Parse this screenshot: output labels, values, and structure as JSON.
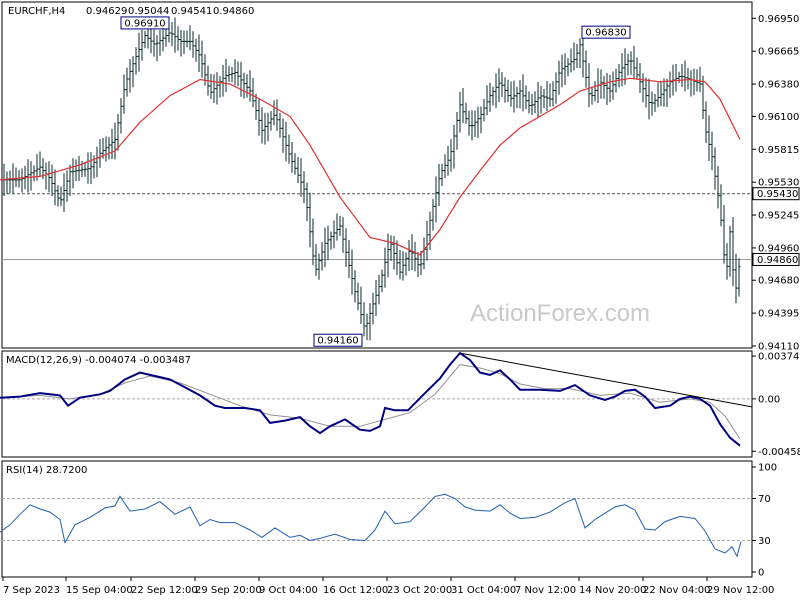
{
  "chart_data": [
    {
      "type": "bar",
      "subtype": "ohlc",
      "title": "EURCHF,H4",
      "ohlc_header": [
        "0.94629",
        "0.95044",
        "0.94541",
        "0.94860"
      ],
      "ylim": [
        0.9411,
        0.9697
      ],
      "yticks": [
        "0.96950",
        "0.96665",
        "0.96380",
        "0.96100",
        "0.95815",
        "0.95530",
        "0.95245",
        "0.94960",
        "0.94680",
        "0.94395",
        "0.94110"
      ],
      "xticks": [
        "7 Sep 2023",
        "15 Sep 04:00",
        "22 Sep 12:00",
        "29 Sep 20:00",
        "9 Oct 04:00",
        "16 Oct 12:00",
        "23 Oct 20:00",
        "31 Oct 04:00",
        "7 Nov 12:00",
        "14 Nov 20:00",
        "22 Nov 04:00",
        "29 Nov 12:00"
      ],
      "price_trajectory": [
        [
          0,
          0.9555
        ],
        [
          20,
          0.9555
        ],
        [
          40,
          0.9566
        ],
        [
          50,
          0.9556
        ],
        [
          60,
          0.9535
        ],
        [
          70,
          0.9562
        ],
        [
          90,
          0.9565
        ],
        [
          100,
          0.9578
        ],
        [
          115,
          0.959
        ],
        [
          125,
          0.9638
        ],
        [
          135,
          0.966
        ],
        [
          145,
          0.968
        ],
        [
          155,
          0.9672
        ],
        [
          170,
          0.9683
        ],
        [
          180,
          0.9675
        ],
        [
          190,
          0.9675
        ],
        [
          200,
          0.9662
        ],
        [
          210,
          0.963
        ],
        [
          225,
          0.9645
        ],
        [
          235,
          0.9648
        ],
        [
          250,
          0.9632
        ],
        [
          262,
          0.9598
        ],
        [
          275,
          0.9612
        ],
        [
          290,
          0.9575
        ],
        [
          305,
          0.9545
        ],
        [
          315,
          0.9475
        ],
        [
          325,
          0.95
        ],
        [
          340,
          0.9515
        ],
        [
          355,
          0.9458
        ],
        [
          365,
          0.9425
        ],
        [
          372,
          0.9445
        ],
        [
          380,
          0.9465
        ],
        [
          390,
          0.9502
        ],
        [
          400,
          0.9475
        ],
        [
          410,
          0.9495
        ],
        [
          420,
          0.9478
        ],
        [
          430,
          0.952
        ],
        [
          440,
          0.956
        ],
        [
          450,
          0.9575
        ],
        [
          460,
          0.962
        ],
        [
          470,
          0.96
        ],
        [
          480,
          0.961
        ],
        [
          490,
          0.9628
        ],
        [
          500,
          0.964
        ],
        [
          510,
          0.9625
        ],
        [
          520,
          0.9632
        ],
        [
          530,
          0.9618
        ],
        [
          540,
          0.9628
        ],
        [
          550,
          0.9625
        ],
        [
          560,
          0.965
        ],
        [
          575,
          0.966
        ],
        [
          580,
          0.9672
        ],
        [
          590,
          0.9625
        ],
        [
          600,
          0.964
        ],
        [
          610,
          0.9632
        ],
        [
          620,
          0.965
        ],
        [
          630,
          0.966
        ],
        [
          640,
          0.964
        ],
        [
          650,
          0.962
        ],
        [
          660,
          0.9628
        ],
        [
          670,
          0.964
        ],
        [
          680,
          0.9645
        ],
        [
          690,
          0.9642
        ],
        [
          700,
          0.9638
        ],
        [
          705,
          0.96
        ],
        [
          712,
          0.9575
        ],
        [
          720,
          0.953
        ],
        [
          726,
          0.947
        ],
        [
          730,
          0.951
        ],
        [
          735,
          0.9455
        ],
        [
          740,
          0.9486
        ]
      ],
      "moving_average": [
        [
          0,
          0.9555
        ],
        [
          40,
          0.9558
        ],
        [
          80,
          0.9568
        ],
        [
          115,
          0.958
        ],
        [
          140,
          0.9605
        ],
        [
          170,
          0.9628
        ],
        [
          200,
          0.9642
        ],
        [
          230,
          0.9638
        ],
        [
          260,
          0.9625
        ],
        [
          290,
          0.961
        ],
        [
          310,
          0.9585
        ],
        [
          340,
          0.954
        ],
        [
          370,
          0.9505
        ],
        [
          395,
          0.95
        ],
        [
          420,
          0.949
        ],
        [
          440,
          0.9512
        ],
        [
          460,
          0.954
        ],
        [
          480,
          0.9563
        ],
        [
          500,
          0.9585
        ],
        [
          520,
          0.96
        ],
        [
          540,
          0.961
        ],
        [
          560,
          0.962
        ],
        [
          580,
          0.9632
        ],
        [
          610,
          0.964
        ],
        [
          630,
          0.9643
        ],
        [
          660,
          0.964
        ],
        [
          690,
          0.9642
        ],
        [
          705,
          0.964
        ],
        [
          720,
          0.9625
        ],
        [
          740,
          0.959
        ]
      ],
      "moving_average_color": "#e03030",
      "bar_color": "#0a2a2a",
      "price_labels": [
        {
          "text": "0.96910",
          "value": 0.9691,
          "x": 145
        },
        {
          "text": "0.96830",
          "value": 0.9683,
          "x": 606
        },
        {
          "text": "0.94160",
          "value": 0.9416,
          "x": 338
        }
      ],
      "reference_levels": [
        {
          "value": 0.9543,
          "label": "0.95430",
          "style": "dashed"
        },
        {
          "value": 0.9486,
          "label": "0.94860",
          "style": "solid"
        }
      ],
      "watermark": "ActionForex.com"
    },
    {
      "type": "line",
      "title": "MACD(12,26,9) -0.004074 -0.003487",
      "ylim": [
        -0.005,
        0.0041
      ],
      "yticks": [
        "0.003743",
        "0.00",
        "-0.004585"
      ],
      "macd_trajectory": [
        [
          0,
          0.0001
        ],
        [
          20,
          0.0002
        ],
        [
          40,
          0.0005
        ],
        [
          50,
          0.0004
        ],
        [
          60,
          0.0003
        ],
        [
          68,
          -0.0006
        ],
        [
          80,
          0.0001
        ],
        [
          100,
          0.0004
        ],
        [
          110,
          0.0007
        ],
        [
          125,
          0.0017
        ],
        [
          140,
          0.0023
        ],
        [
          150,
          0.0021
        ],
        [
          160,
          0.0019
        ],
        [
          170,
          0.0017
        ],
        [
          185,
          0.001
        ],
        [
          200,
          0.0003
        ],
        [
          215,
          -0.0006
        ],
        [
          225,
          -0.0008
        ],
        [
          245,
          -0.0008
        ],
        [
          260,
          -0.001
        ],
        [
          270,
          -0.0021
        ],
        [
          285,
          -0.0019
        ],
        [
          300,
          -0.0016
        ],
        [
          310,
          -0.0024
        ],
        [
          320,
          -0.003
        ],
        [
          330,
          -0.0024
        ],
        [
          345,
          -0.0018
        ],
        [
          360,
          -0.0027
        ],
        [
          370,
          -0.0028
        ],
        [
          380,
          -0.0024
        ],
        [
          385,
          -0.0008
        ],
        [
          395,
          -0.001
        ],
        [
          408,
          -0.001
        ],
        [
          425,
          0.0005
        ],
        [
          440,
          0.0018
        ],
        [
          450,
          0.003
        ],
        [
          460,
          0.004
        ],
        [
          470,
          0.0034
        ],
        [
          480,
          0.0023
        ],
        [
          490,
          0.0021
        ],
        [
          500,
          0.0025
        ],
        [
          510,
          0.0017
        ],
        [
          520,
          0.0008
        ],
        [
          540,
          0.0008
        ],
        [
          560,
          0.0007
        ],
        [
          575,
          0.0012
        ],
        [
          590,
          0.0003
        ],
        [
          605,
          -0.0001
        ],
        [
          615,
          0.0002
        ],
        [
          625,
          0.0007
        ],
        [
          635,
          0.0008
        ],
        [
          645,
          0.0002
        ],
        [
          655,
          -0.0008
        ],
        [
          670,
          -0.0006
        ],
        [
          680,
          0.0
        ],
        [
          690,
          0.0002
        ],
        [
          700,
          0.0
        ],
        [
          710,
          -0.0006
        ],
        [
          720,
          -0.0022
        ],
        [
          730,
          -0.0034
        ],
        [
          740,
          -0.0041
        ]
      ],
      "signal_trajectory": [
        [
          0,
          0.0001
        ],
        [
          40,
          0.0003
        ],
        [
          70,
          0.0
        ],
        [
          100,
          0.0004
        ],
        [
          125,
          0.0014
        ],
        [
          150,
          0.002
        ],
        [
          180,
          0.0014
        ],
        [
          210,
          0.0004
        ],
        [
          240,
          -0.0006
        ],
        [
          270,
          -0.0014
        ],
        [
          300,
          -0.0017
        ],
        [
          330,
          -0.0024
        ],
        [
          360,
          -0.0024
        ],
        [
          385,
          -0.0018
        ],
        [
          410,
          -0.0012
        ],
        [
          435,
          0.0004
        ],
        [
          460,
          0.003
        ],
        [
          480,
          0.0027
        ],
        [
          500,
          0.0022
        ],
        [
          520,
          0.0013
        ],
        [
          545,
          0.0009
        ],
        [
          570,
          0.0009
        ],
        [
          600,
          0.0003
        ],
        [
          630,
          0.0005
        ],
        [
          660,
          -0.0003
        ],
        [
          690,
          0.0
        ],
        [
          710,
          -0.0003
        ],
        [
          725,
          -0.0015
        ],
        [
          740,
          -0.0035
        ]
      ],
      "trendline": [
        [
          460,
          0.004
        ],
        [
          752,
          -0.0007
        ]
      ],
      "macd_color": "#000080",
      "signal_color": "#909090"
    },
    {
      "type": "line",
      "title": "RSI(14) 28.7200",
      "ylim": [
        0,
        100
      ],
      "yticks": [
        "100",
        "70",
        "30",
        "0"
      ],
      "levels": [
        70,
        30
      ],
      "rsi_trajectory": [
        [
          0,
          38
        ],
        [
          10,
          45
        ],
        [
          20,
          55
        ],
        [
          30,
          64
        ],
        [
          40,
          60
        ],
        [
          50,
          57
        ],
        [
          60,
          50
        ],
        [
          65,
          28
        ],
        [
          75,
          45
        ],
        [
          90,
          52
        ],
        [
          105,
          61
        ],
        [
          115,
          63
        ],
        [
          120,
          72
        ],
        [
          130,
          58
        ],
        [
          145,
          60
        ],
        [
          160,
          67
        ],
        [
          175,
          55
        ],
        [
          190,
          62
        ],
        [
          200,
          44
        ],
        [
          210,
          50
        ],
        [
          220,
          47
        ],
        [
          235,
          47
        ],
        [
          250,
          40
        ],
        [
          262,
          33
        ],
        [
          275,
          42
        ],
        [
          290,
          33
        ],
        [
          300,
          35
        ],
        [
          310,
          30
        ],
        [
          320,
          32
        ],
        [
          335,
          36
        ],
        [
          350,
          31
        ],
        [
          365,
          30
        ],
        [
          375,
          40
        ],
        [
          385,
          58
        ],
        [
          395,
          46
        ],
        [
          410,
          48
        ],
        [
          425,
          62
        ],
        [
          435,
          72
        ],
        [
          445,
          74
        ],
        [
          455,
          70
        ],
        [
          465,
          62
        ],
        [
          475,
          59
        ],
        [
          490,
          58
        ],
        [
          500,
          64
        ],
        [
          510,
          56
        ],
        [
          520,
          51
        ],
        [
          535,
          52
        ],
        [
          550,
          57
        ],
        [
          565,
          66
        ],
        [
          575,
          70
        ],
        [
          585,
          42
        ],
        [
          595,
          50
        ],
        [
          605,
          56
        ],
        [
          615,
          62
        ],
        [
          625,
          64
        ],
        [
          635,
          59
        ],
        [
          645,
          41
        ],
        [
          655,
          40
        ],
        [
          665,
          48
        ],
        [
          680,
          53
        ],
        [
          695,
          51
        ],
        [
          705,
          39
        ],
        [
          715,
          22
        ],
        [
          725,
          18
        ],
        [
          732,
          24
        ],
        [
          737,
          15
        ],
        [
          741,
          29
        ]
      ],
      "rsi_color": "#1f5fb0"
    }
  ]
}
